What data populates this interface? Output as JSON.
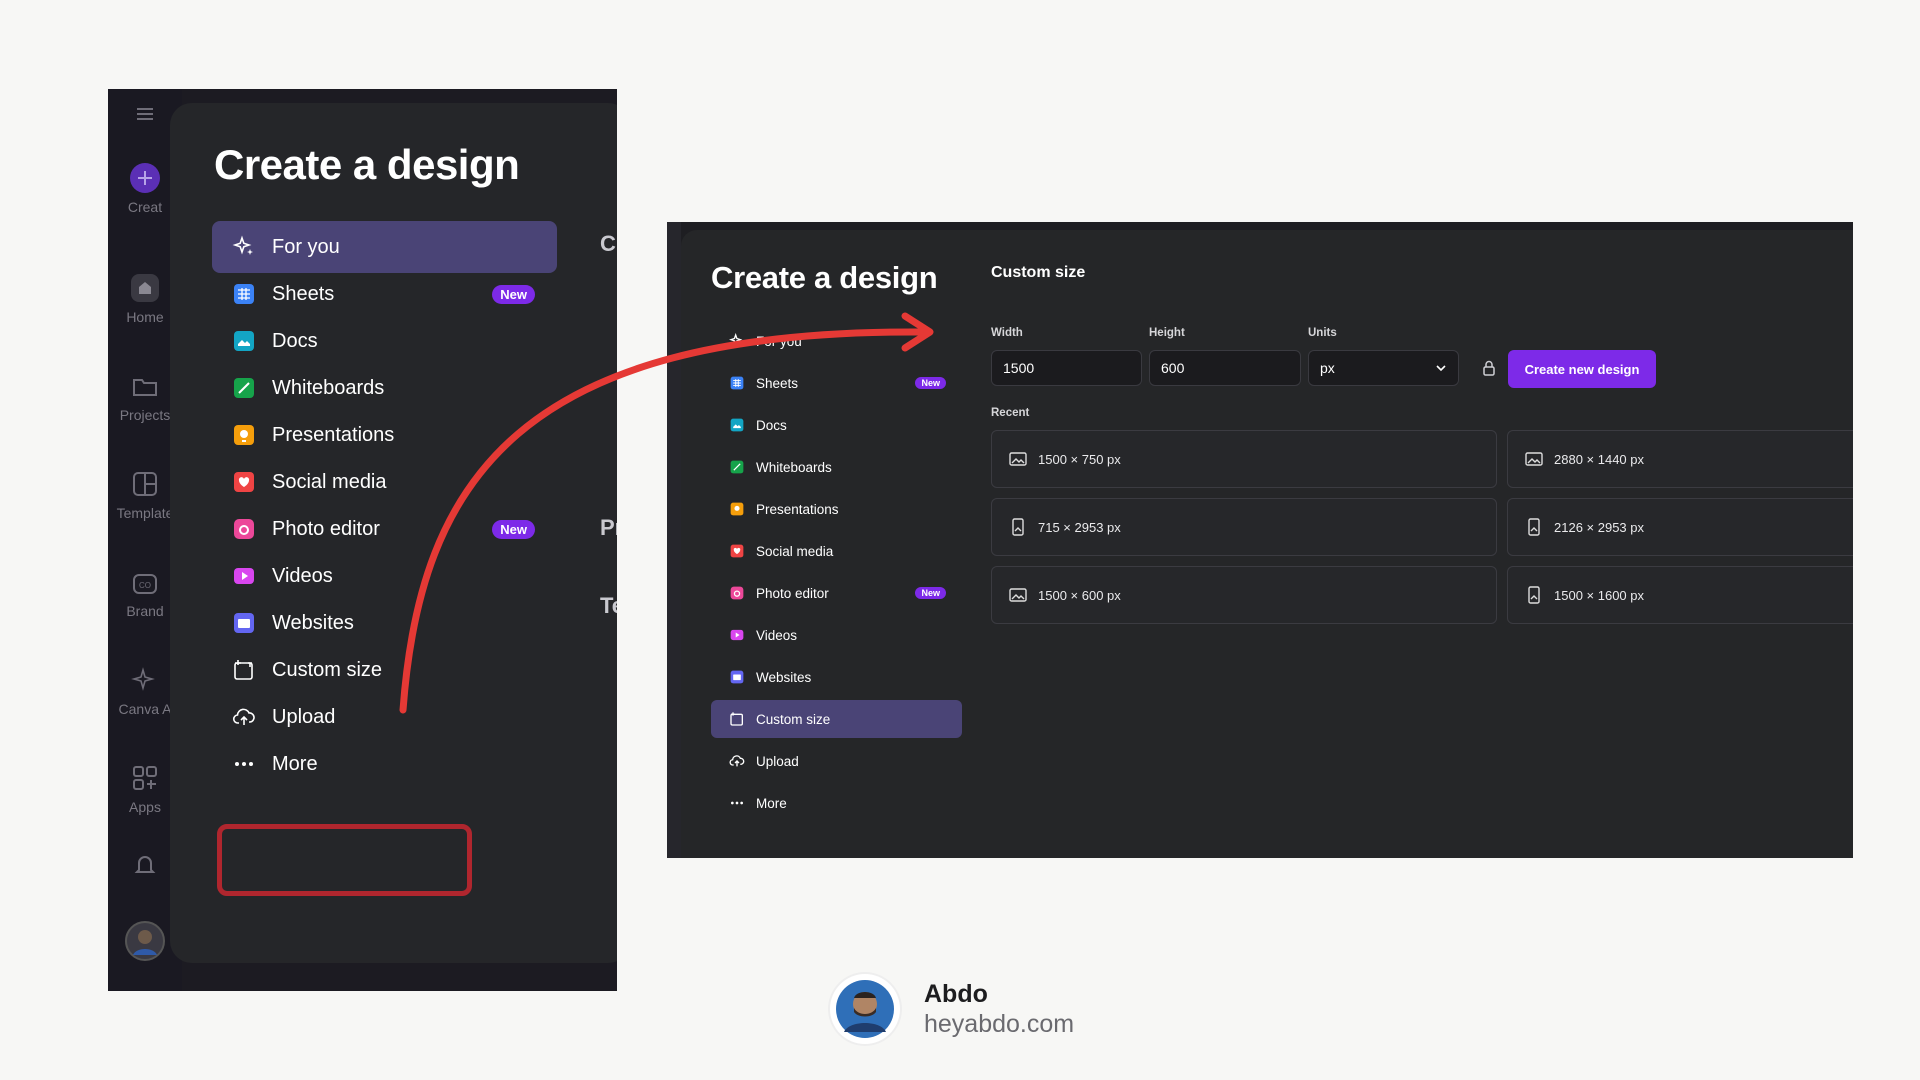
{
  "left": {
    "title": "Create a design",
    "rail": [
      {
        "label": "Creat",
        "icon": "plus-icon"
      },
      {
        "label": "Home",
        "icon": "home-icon"
      },
      {
        "label": "Projects",
        "icon": "folder-icon"
      },
      {
        "label": "Template",
        "icon": "template-icon"
      },
      {
        "label": "Brand",
        "icon": "brand-icon"
      },
      {
        "label": "Canva A",
        "icon": "sparkle-icon"
      },
      {
        "label": "Apps",
        "icon": "apps-icon"
      }
    ],
    "items": [
      {
        "label": "For you",
        "icon": "sparkle-icon",
        "active": true
      },
      {
        "label": "Sheets",
        "icon": "sheets-icon",
        "badge": "New"
      },
      {
        "label": "Docs",
        "icon": "docs-icon"
      },
      {
        "label": "Whiteboards",
        "icon": "whiteboards-icon"
      },
      {
        "label": "Presentations",
        "icon": "presentations-icon"
      },
      {
        "label": "Social media",
        "icon": "social-media-icon"
      },
      {
        "label": "Photo editor",
        "icon": "camera-icon",
        "badge": "New"
      },
      {
        "label": "Videos",
        "icon": "video-icon"
      },
      {
        "label": "Websites",
        "icon": "websites-icon"
      },
      {
        "label": "Custom size",
        "icon": "custom-size-icon",
        "highlighted": true
      },
      {
        "label": "Upload",
        "icon": "upload-icon"
      },
      {
        "label": "More",
        "icon": "more-icon"
      }
    ],
    "edge_text": [
      "C",
      "Pr",
      "Te"
    ]
  },
  "right": {
    "title": "Create a design",
    "items": [
      {
        "label": "For you",
        "icon": "sparkle-icon"
      },
      {
        "label": "Sheets",
        "icon": "sheets-icon",
        "badge": "New"
      },
      {
        "label": "Docs",
        "icon": "docs-icon"
      },
      {
        "label": "Whiteboards",
        "icon": "whiteboards-icon"
      },
      {
        "label": "Presentations",
        "icon": "presentations-icon"
      },
      {
        "label": "Social media",
        "icon": "social-media-icon"
      },
      {
        "label": "Photo editor",
        "icon": "camera-icon",
        "badge": "New"
      },
      {
        "label": "Videos",
        "icon": "video-icon"
      },
      {
        "label": "Websites",
        "icon": "websites-icon"
      },
      {
        "label": "Custom size",
        "icon": "custom-size-icon",
        "active": true
      },
      {
        "label": "Upload",
        "icon": "upload-icon"
      },
      {
        "label": "More",
        "icon": "more-icon"
      }
    ],
    "custom_size": {
      "heading": "Custom size",
      "width_label": "Width",
      "width_value": "1500",
      "height_label": "Height",
      "height_value": "600",
      "units_label": "Units",
      "units_value": "px",
      "create_button": "Create new design",
      "recent_label": "Recent",
      "recent": [
        {
          "label": "1500 × 750 px",
          "icon": "landscape-image-icon"
        },
        {
          "label": "2880 × 1440 px",
          "icon": "landscape-image-icon"
        },
        {
          "label": "715 × 2953 px",
          "icon": "portrait-image-icon"
        },
        {
          "label": "2126 × 2953 px",
          "icon": "portrait-image-icon"
        },
        {
          "label": "1500 × 600 px",
          "icon": "landscape-image-icon"
        },
        {
          "label": "1500 × 1600 px",
          "icon": "portrait-image-icon"
        }
      ]
    }
  },
  "author": {
    "name": "Abdo",
    "site": "heyabdo.com"
  },
  "colors": {
    "accent": "#7d2ae8",
    "active_item": "#4a4476",
    "highlight": "#b0262e",
    "arrow": "#e53935",
    "panel": "#252629",
    "page_bg": "#f7f7f5"
  }
}
